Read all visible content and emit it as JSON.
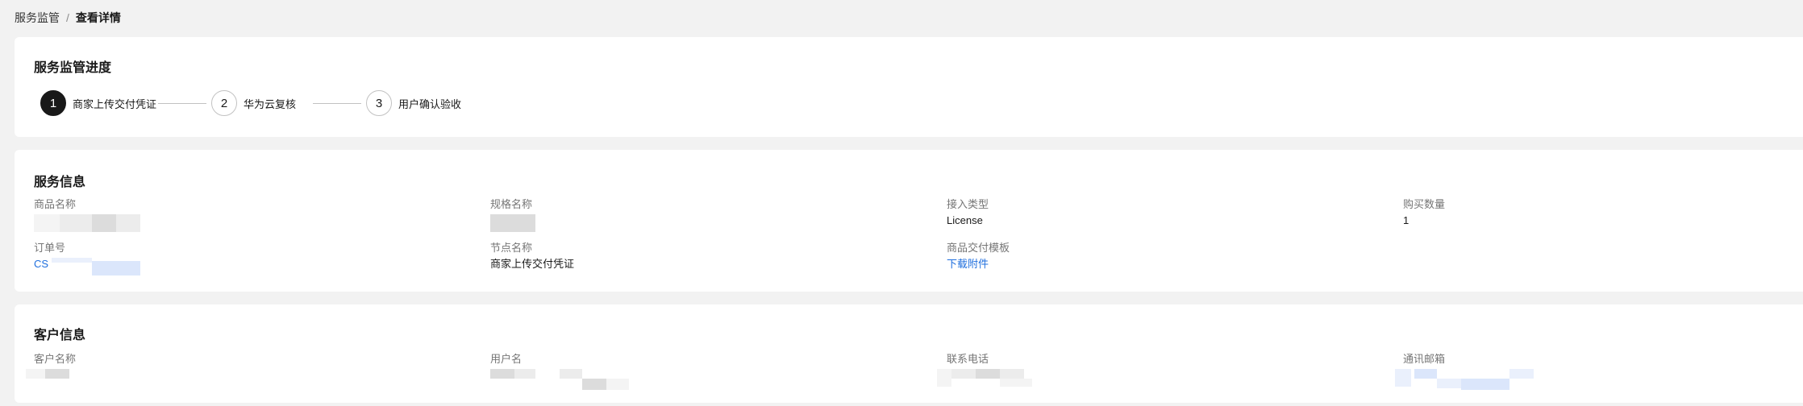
{
  "breadcrumb": {
    "parent": "服务监管",
    "separator": "/",
    "current": "查看详情"
  },
  "progress": {
    "title": "服务监管进度",
    "steps": [
      {
        "number": "1",
        "label": "商家上传交付凭证",
        "state": "active"
      },
      {
        "number": "2",
        "label": "华为云复核",
        "state": "pending"
      },
      {
        "number": "3",
        "label": "用户确认验收",
        "state": "pending"
      }
    ]
  },
  "service_info": {
    "title": "服务信息",
    "product_name": {
      "label": "商品名称",
      "value": ""
    },
    "spec_name": {
      "label": "规格名称",
      "value": ""
    },
    "access_type": {
      "label": "接入类型",
      "value": "License"
    },
    "purchase_qty": {
      "label": "购买数量",
      "value": "1"
    },
    "order_no": {
      "label": "订单号",
      "value": "CS"
    },
    "node_name": {
      "label": "节点名称",
      "value": "商家上传交付凭证"
    },
    "delivery_template": {
      "label": "商品交付模板",
      "value": "下载附件"
    }
  },
  "customer_info": {
    "title": "客户信息",
    "customer_name": {
      "label": "客户名称",
      "value": ""
    },
    "username": {
      "label": "用户名",
      "value": ""
    },
    "phone": {
      "label": "联系电话",
      "value": ""
    },
    "email": {
      "label": "通讯邮箱",
      "value": ""
    }
  },
  "colors": {
    "accent_link": "#1f6fde",
    "step_active": "#191919",
    "background": "#f2f2f2"
  }
}
